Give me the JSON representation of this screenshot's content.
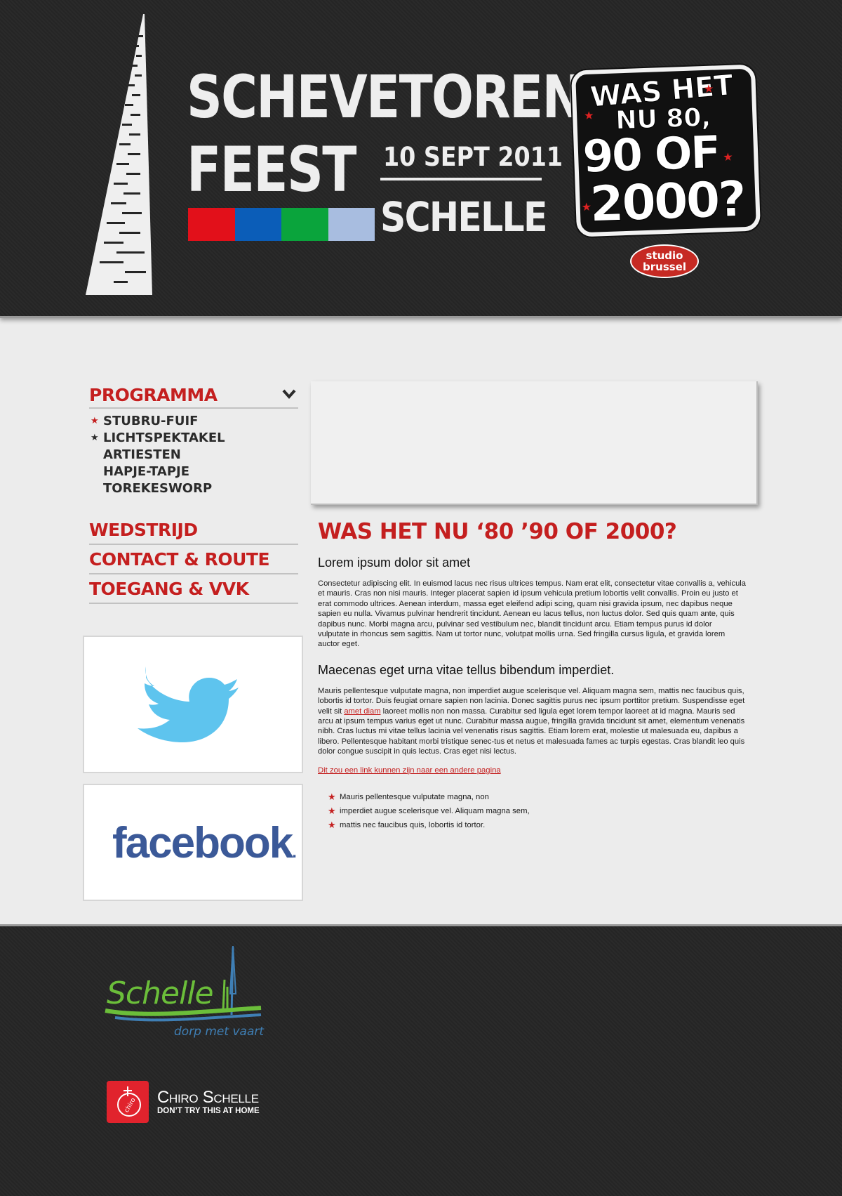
{
  "header": {
    "logo_line1": "SCHEVETOREN",
    "logo_line2": "FEEST",
    "date": "10 SEPT 2011",
    "city": "SCHELLE",
    "color_bar": [
      "#e2101a",
      "#0b5db8",
      "#0aa43c",
      "#a8bde0"
    ],
    "promo": {
      "line1": "WAS HET",
      "line2": "NU 80,",
      "line3": "90 OF",
      "line4": "2000?"
    },
    "radio_badge": {
      "line1": "studio",
      "line2": "brussel"
    }
  },
  "nav": {
    "programma": "PROGRAMMA",
    "programma_items": [
      {
        "label": "STUBRU-FUIF",
        "bullet": "★",
        "bullet_color": "#c41f1f"
      },
      {
        "label": "LICHTSPEKTAKEL",
        "bullet": "★",
        "bullet_color": "#2b2b2b"
      },
      {
        "label": "ARTIESTEN",
        "bullet": "",
        "bullet_color": ""
      },
      {
        "label": "HAPJE-TAPJE",
        "bullet": "",
        "bullet_color": ""
      },
      {
        "label": "TOREKESWORP",
        "bullet": "",
        "bullet_color": ""
      }
    ],
    "wedstrijd": "WEDSTRIJD",
    "contact": "CONTACT & ROUTE",
    "toegang": "TOEGANG & VVK"
  },
  "social": {
    "twitter_icon": "twitter-bird-icon",
    "facebook_label": "facebook",
    "facebook_dot": "."
  },
  "content": {
    "heading": "WAS HET NU ‘80 ’90 OF 2000?",
    "subheading1": "Lorem ipsum dolor sit amet",
    "paragraph1": "Consectetur adipiscing elit. In euismod lacus nec risus ultrices tempus. Nam erat elit, consectetur vitae convallis a, vehicula et mauris. Cras non nisi mauris. Integer placerat sapien id ipsum vehicula pretium lobortis velit convallis. Proin eu justo et erat commodo ultrices. Aenean interdum, massa eget eleifend adipi scing, quam nisi gravida ipsum, nec dapibus neque sapien eu nulla. Vivamus pulvinar hendrerit tincidunt. Aenean eu lacus tellus, non luctus dolor. Sed quis quam ante, quis dapibus nunc. Morbi magna arcu, pulvinar sed vestibulum nec, blandit tincidunt arcu. Etiam tempus purus id dolor vulputate in rhoncus sem sagittis. Nam ut tortor nunc, volutpat mollis urna. Sed fringilla cursus ligula, et gravida lorem auctor eget.",
    "subheading2": "Maecenas eget urna vitae tellus bibendum imperdiet.",
    "paragraph2_before": "Mauris pellentesque vulputate magna, non imperdiet augue scelerisque vel. Aliquam magna sem, mattis nec faucibus quis, lobortis id tortor. Duis feugiat ornare sapien non lacinia. Donec sagittis purus nec ipsum porttitor pretium. Suspendisse eget velit sit ",
    "paragraph2_link": "amet diam",
    "paragraph2_after": " laoreet mollis non non massa. Curabitur sed ligula eget lorem tempor laoreet at id magna. Mauris sed arcu at ipsum tempus varius eget ut nunc. Curabitur massa augue, fringilla gravida tincidunt sit amet, elementum venenatis nibh. Cras luctus mi vitae tellus lacinia vel venenatis risus sagittis. Etiam lorem erat, molestie ut malesuada eu, dapibus a libero. Pellentesque habitant morbi tristique senec-tus et netus et malesuada fames ac turpis egestas. Cras blandit leo quis dolor congue suscipit in quis lectus. Cras eget nisi lectus.",
    "page_link": "Dit zou een link kunnen zijn naar een andere pagina",
    "list_items": [
      "Mauris pellentesque vulputate magna, non",
      "imperdiet augue scelerisque vel. Aliquam magna sem,",
      "mattis nec faucibus quis, lobortis id tortor."
    ],
    "list_bullet": "★"
  },
  "footer": {
    "schelle_word": "Schelle",
    "schelle_tagline": "dorp met vaart",
    "chiro_name": "Chiro Schelle",
    "chiro_slogan": "DON’T TRY THIS AT HOME",
    "chiro_badge_text": "chiro"
  },
  "colors": {
    "accent_red": "#c41f1f",
    "dark_bg": "#252525",
    "twitter_blue": "#5ec4ee",
    "facebook_blue": "#3b5998",
    "schelle_green": "#6bbe3a",
    "schelle_blue": "#3f7fb5",
    "chiro_red": "#e1232d"
  }
}
